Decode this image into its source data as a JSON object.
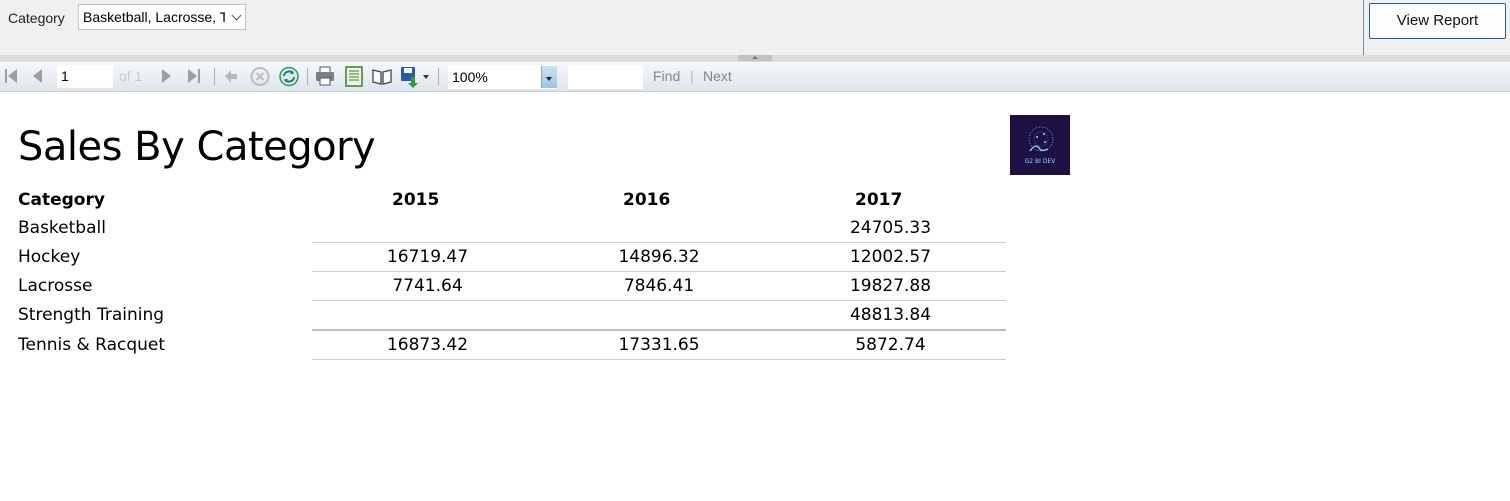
{
  "parameters": {
    "category_label": "Category",
    "category_value": "Basketball, Lacrosse, T",
    "view_report_label": "View Report"
  },
  "toolbar": {
    "page_number": "1",
    "of_text": "of 1",
    "zoom": "100%",
    "find_value": "",
    "find_label": "Find",
    "separator": "|",
    "next_label": "Next"
  },
  "report": {
    "title": "Sales By Category",
    "logo_text": "G2 BI DEV",
    "columns": [
      "Category",
      "2015",
      "2016",
      "2017"
    ],
    "rows": [
      {
        "category": "Basketball",
        "y2015": "",
        "y2016": "",
        "y2017": "24705.33"
      },
      {
        "category": "Hockey",
        "y2015": "16719.47",
        "y2016": "14896.32",
        "y2017": "12002.57"
      },
      {
        "category": "Lacrosse",
        "y2015": "7741.64",
        "y2016": "7846.41",
        "y2017": "19827.88"
      },
      {
        "category": "Strength Training",
        "y2015": "",
        "y2016": "",
        "y2017": "48813.84"
      },
      {
        "category": "Tennis & Racquet",
        "y2015": "16873.42",
        "y2016": "17331.65",
        "y2017": "5872.74"
      }
    ]
  },
  "colors": {
    "accent": "#2b5f8c",
    "logo_bg": "#1c1142",
    "toolbar_icon_green": "#2e9b4a",
    "toolbar_icon_blue": "#2a6fb4"
  }
}
